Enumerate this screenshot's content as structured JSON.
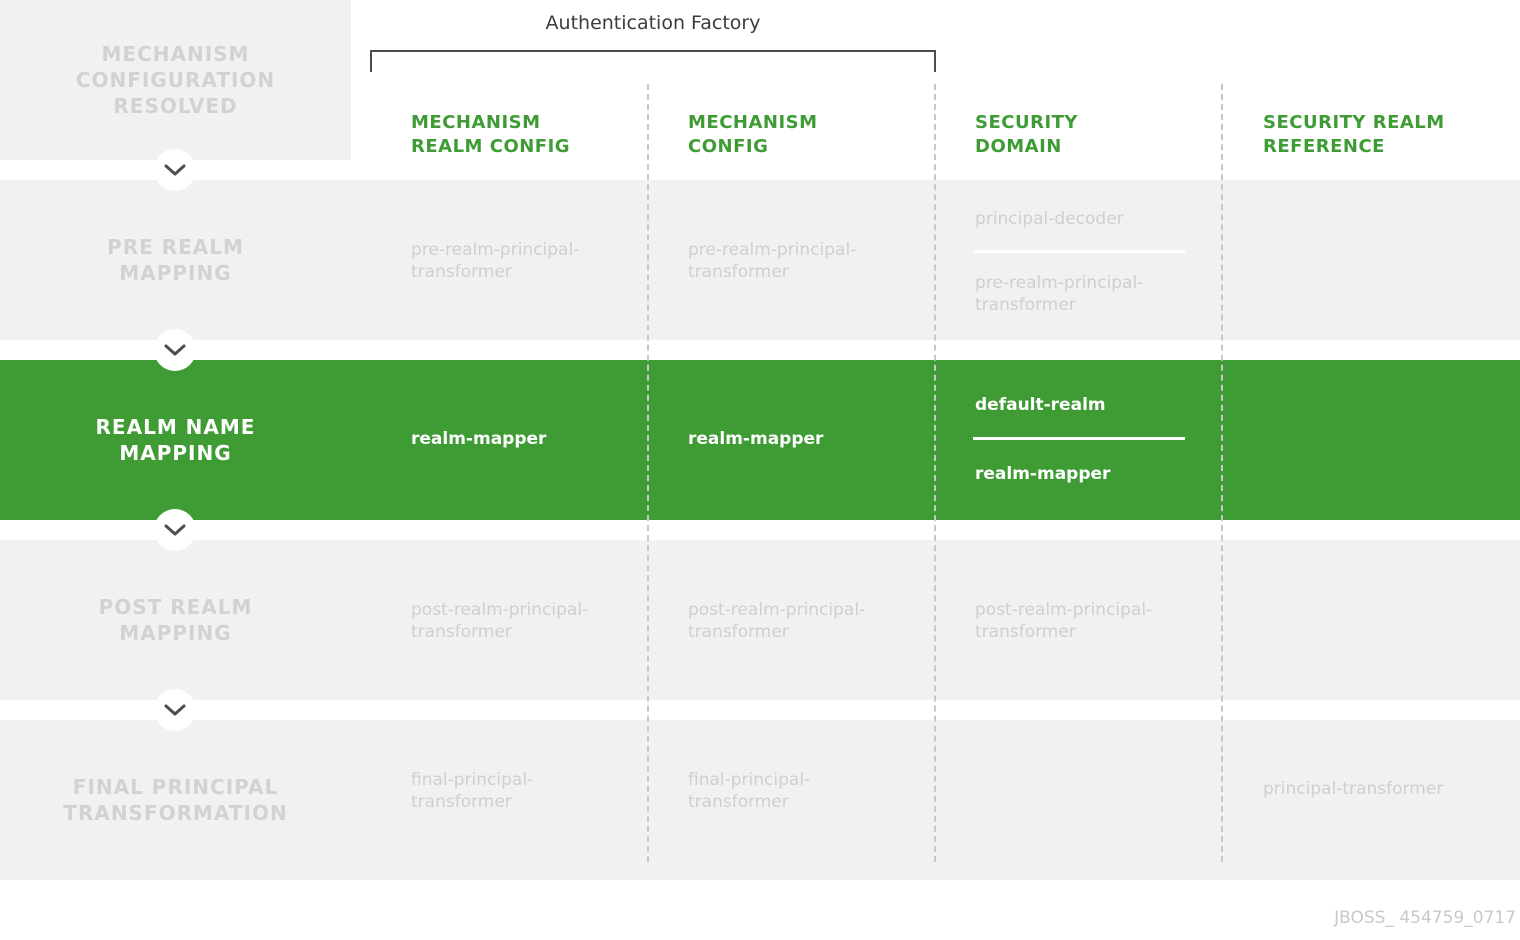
{
  "header": {
    "factory_label": "Authentication Factory",
    "resolved_label": "MECHANISM\nCONFIGURATION\nRESOLVED"
  },
  "columns": [
    "MECHANISM\nREALM CONFIG",
    "MECHANISM\nCONFIG",
    "SECURITY\nDOMAIN",
    "SECURITY REALM\nREFERENCE"
  ],
  "stages": [
    {
      "label": "PRE REALM\nMAPPING",
      "cells": [
        "pre-realm-principal-\ntransformer",
        "pre-realm-principal-\ntransformer",
        [
          "principal-decoder",
          "pre-realm-principal-\ntransformer"
        ],
        ""
      ]
    },
    {
      "label": "REALM NAME\nMAPPING",
      "cells": [
        "realm-mapper",
        "realm-mapper",
        [
          "default-realm",
          "realm-mapper"
        ],
        ""
      ]
    },
    {
      "label": "POST REALM\nMAPPING",
      "cells": [
        "post-realm-principal-\ntransformer",
        "post-realm-principal-\ntransformer",
        "post-realm-principal-\ntransformer",
        ""
      ]
    },
    {
      "label": "FINAL PRINCIPAL\nTRANSFORMATION",
      "cells": [
        "final-principal-\ntransformer",
        "final-principal-\ntransformer",
        "",
        "principal-transformer"
      ]
    }
  ],
  "footer": {
    "id": "JBOSS_ 454759_0717"
  },
  "colors": {
    "accent_green": "#3f9c35",
    "band_gray": "#f1f1f1",
    "muted_text": "#cfcfcf"
  }
}
